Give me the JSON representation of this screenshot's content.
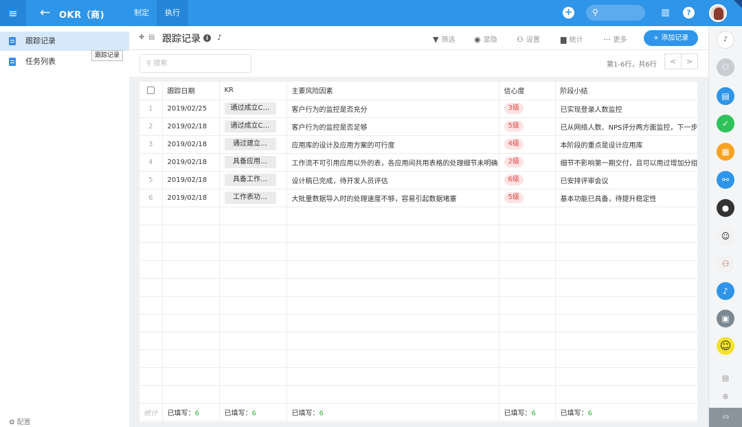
{
  "topbar": {
    "menu_icon": "hamburger-menu-icon",
    "back_icon": "arrow-left-icon",
    "app_title": "OKR（商)",
    "tabs": [
      {
        "label": "制定"
      },
      {
        "label": "执行"
      }
    ],
    "search_icon": "search-icon",
    "brand_color": "#2f95e8"
  },
  "sidebar": {
    "items": [
      {
        "label": "跟踪记录",
        "active": true
      },
      {
        "label": "任务列表",
        "active": false
      }
    ],
    "tooltip": "跟踪记录",
    "config_label": "配置"
  },
  "header": {
    "title": "跟踪记录",
    "tools": [
      {
        "icon": "filter-icon",
        "label": "筛选"
      },
      {
        "icon": "eye-icon",
        "label": "显隐"
      },
      {
        "icon": "users-icon",
        "label": "设置"
      },
      {
        "icon": "bar-chart-icon",
        "label": "统计"
      },
      {
        "icon": "more-icon",
        "label": "更多"
      }
    ],
    "add_button": "+ 添加记录"
  },
  "subbar": {
    "search_placeholder": "搜索",
    "pager_text": "第1-6行，共6行",
    "prev": "<",
    "next": ">"
  },
  "table": {
    "columns": [
      "跟踪日期",
      "KR",
      "主要风险因素",
      "信心度",
      "阶段小结"
    ],
    "rows": [
      {
        "num": "1",
        "date": "2019/02/25",
        "kr": "通过成立C…",
        "risk": "客户行为的监控是否充分",
        "level": "3级",
        "summary": "已实现登录人数监控"
      },
      {
        "num": "2",
        "date": "2019/02/18",
        "kr": "通过成立C…",
        "risk": "客户行为的监控是否足够",
        "level": "5级",
        "summary": "已从网络人数、NPS评分两方面监控，下一步要"
      },
      {
        "num": "3",
        "date": "2019/02/18",
        "kr": "通过建立…",
        "risk": "应用库的设计及应用方案的可行度",
        "level": "4级",
        "summary": "本阶段的重点是设计应用库"
      },
      {
        "num": "4",
        "date": "2019/02/18",
        "kr": "具备应用…",
        "risk": "工作流不可引用应用以外的表，各应用间共用表格的处理细节未明确",
        "level": "2级",
        "summary": "细节不影响第一期交付，且可以用过增加分组来"
      },
      {
        "num": "5",
        "date": "2019/02/18",
        "kr": "具备工作…",
        "risk": "设计稿已完成，待开发人员评估",
        "level": "6级",
        "summary": "已安排评审会议"
      },
      {
        "num": "6",
        "date": "2019/02/18",
        "kr": "工作表功…",
        "risk": "大批量数据导入时的处理速度不够，容易引起数据堵塞",
        "level": "5级",
        "summary": "基本功能已具备，待提升稳定性"
      }
    ],
    "footer": {
      "stat_label": "统计",
      "filled_label": "已填写：",
      "filled_count": "6"
    }
  },
  "rightbar": {
    "icons": [
      "bell-icon",
      "group-avatar-icon",
      "chat-icon",
      "check-icon",
      "table-icon",
      "org-chart-icon",
      "avatar-icon",
      "avatar-icon",
      "group-avatar-icon",
      "notification-icon",
      "briefcase-icon",
      "smiley-icon"
    ]
  }
}
